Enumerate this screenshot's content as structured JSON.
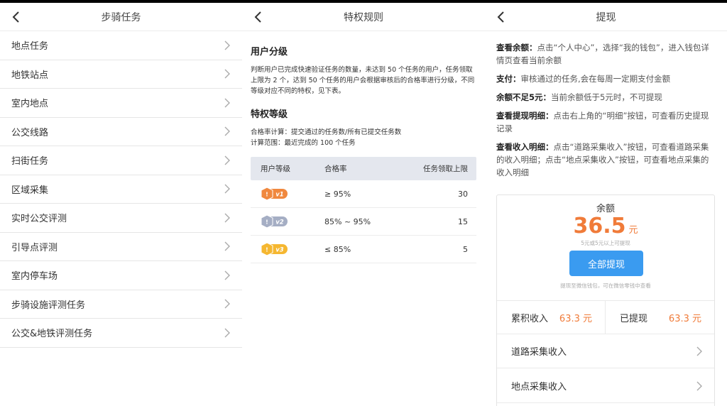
{
  "colors": {
    "accent_orange": "#f07b39",
    "primary_blue": "#3a9bf0",
    "table_header_bg": "#e4e7ee",
    "v1_badge": "#f0883e",
    "v2_badge": "#a5aec4",
    "v3_badge": "#f5b731"
  },
  "panel1": {
    "title": "步骑任务",
    "items": [
      {
        "label": "地点任务"
      },
      {
        "label": "地铁站点"
      },
      {
        "label": "室内地点"
      },
      {
        "label": "公交线路"
      },
      {
        "label": "扫街任务"
      },
      {
        "label": "区域采集"
      },
      {
        "label": "实时公交评测"
      },
      {
        "label": "引导点评测"
      },
      {
        "label": "室内停车场"
      },
      {
        "label": "步骑设施评测任务"
      },
      {
        "label": "公交&地铁评测任务"
      }
    ]
  },
  "panel2": {
    "title": "特权规则",
    "section1_title": "用户分级",
    "section1_text": "判断用户已完成快速验证任务的数量，未达到 50 个任务的用户，任务领取上限为 2 个，达到 50 个任务的用户会根据审核后的合格率进行分级，不同等级对应不同的特权，见下表。",
    "section2_title": "特权等级",
    "section2_line1": "合格率计算：提交通过的任务数/所有已提交任务数",
    "section2_line2": "计算范围：最近完成的 100 个任务",
    "table": {
      "headers": [
        "用户等级",
        "合格率",
        "任务领取上限"
      ],
      "rows": [
        {
          "badge": "v1",
          "badge_icon": "v1-level-badge-icon",
          "rate": "≥ 95%",
          "limit": "30"
        },
        {
          "badge": "v2",
          "badge_icon": "v2-level-badge-icon",
          "rate": "85% ~ 95%",
          "limit": "15"
        },
        {
          "badge": "v3",
          "badge_icon": "v3-level-badge-icon",
          "rate": "≤ 85%",
          "limit": "5"
        }
      ]
    }
  },
  "panel3": {
    "title": "提现",
    "info": [
      {
        "label": "查看余额：",
        "text": "点击“个人中心”，选择“我的钱包”，进入钱包详情页查看当前余额"
      },
      {
        "label": "支付：",
        "text": "审核通过的任务,会在每周一定期支付金额"
      },
      {
        "label": "余额不足5元：",
        "text": "当前余额低于5元时，不可提现"
      },
      {
        "label": "查看提现明细：",
        "text": "点击右上角的“明细”按钮，可查看历史提现记录"
      },
      {
        "label": "查看收入明细：",
        "text": "点击“道路采集收入”按钮，可查看道路采集的收入明细；点击“地点采集收入”按钮，可查看地点采集的收入明细"
      }
    ],
    "balance_label": "余额",
    "balance_value": "36.5",
    "balance_unit": "元",
    "balance_note": "5元或5元以上可提现",
    "withdraw_button": "全部提现",
    "wechat_note": "提现至微信钱包，可在微信零钱中查看",
    "cumulative_label": "累积收入",
    "cumulative_value": "63.3 元",
    "withdrawn_label": "已提现",
    "withdrawn_value": "63.3 元",
    "road_income_label": "道路采集收入",
    "place_income_label": "地点采集收入"
  }
}
